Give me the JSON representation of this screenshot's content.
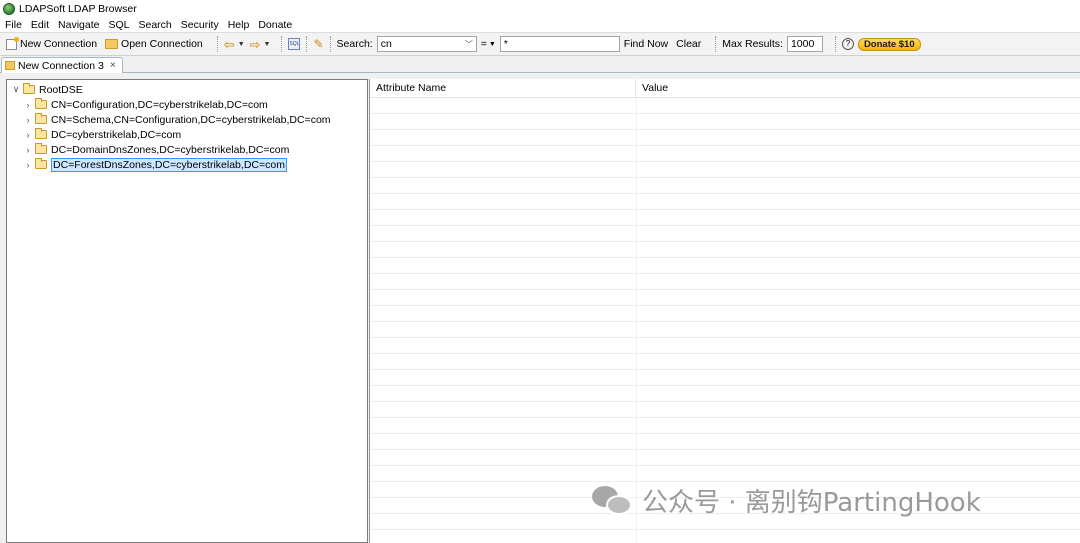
{
  "window": {
    "title": "LDAPSoft LDAP Browser"
  },
  "menu": [
    "File",
    "Edit",
    "Navigate",
    "SQL",
    "Search",
    "Security",
    "Help",
    "Donate"
  ],
  "toolbar": {
    "new_connection": "New Connection",
    "open_connection": "Open Connection",
    "search_label": "Search:",
    "search_attr": "cn",
    "operator": "=",
    "search_value": "*",
    "find_now": "Find Now",
    "clear": "Clear",
    "max_results_label": "Max Results:",
    "max_results": "1000",
    "help": "?",
    "donate": "Donate $10"
  },
  "tab": {
    "label": "New Connection 3",
    "close": "×"
  },
  "tree": {
    "root": "RootDSE",
    "children": [
      "CN=Configuration,DC=cyberstrikelab,DC=com",
      "CN=Schema,CN=Configuration,DC=cyberstrikelab,DC=com",
      "DC=cyberstrikelab,DC=com",
      "DC=DomainDnsZones,DC=cyberstrikelab,DC=com",
      "DC=ForestDnsZones,DC=cyberstrikelab,DC=com"
    ],
    "selected_index": 4
  },
  "grid": {
    "columns": [
      "Attribute Name",
      "Value"
    ]
  },
  "watermark": {
    "text": "公众号 · 离别钩PartingHook"
  },
  "colors": {
    "selection_bg": "#cce8ff",
    "selection_border": "#3399ff",
    "donate": "#f4b400"
  }
}
